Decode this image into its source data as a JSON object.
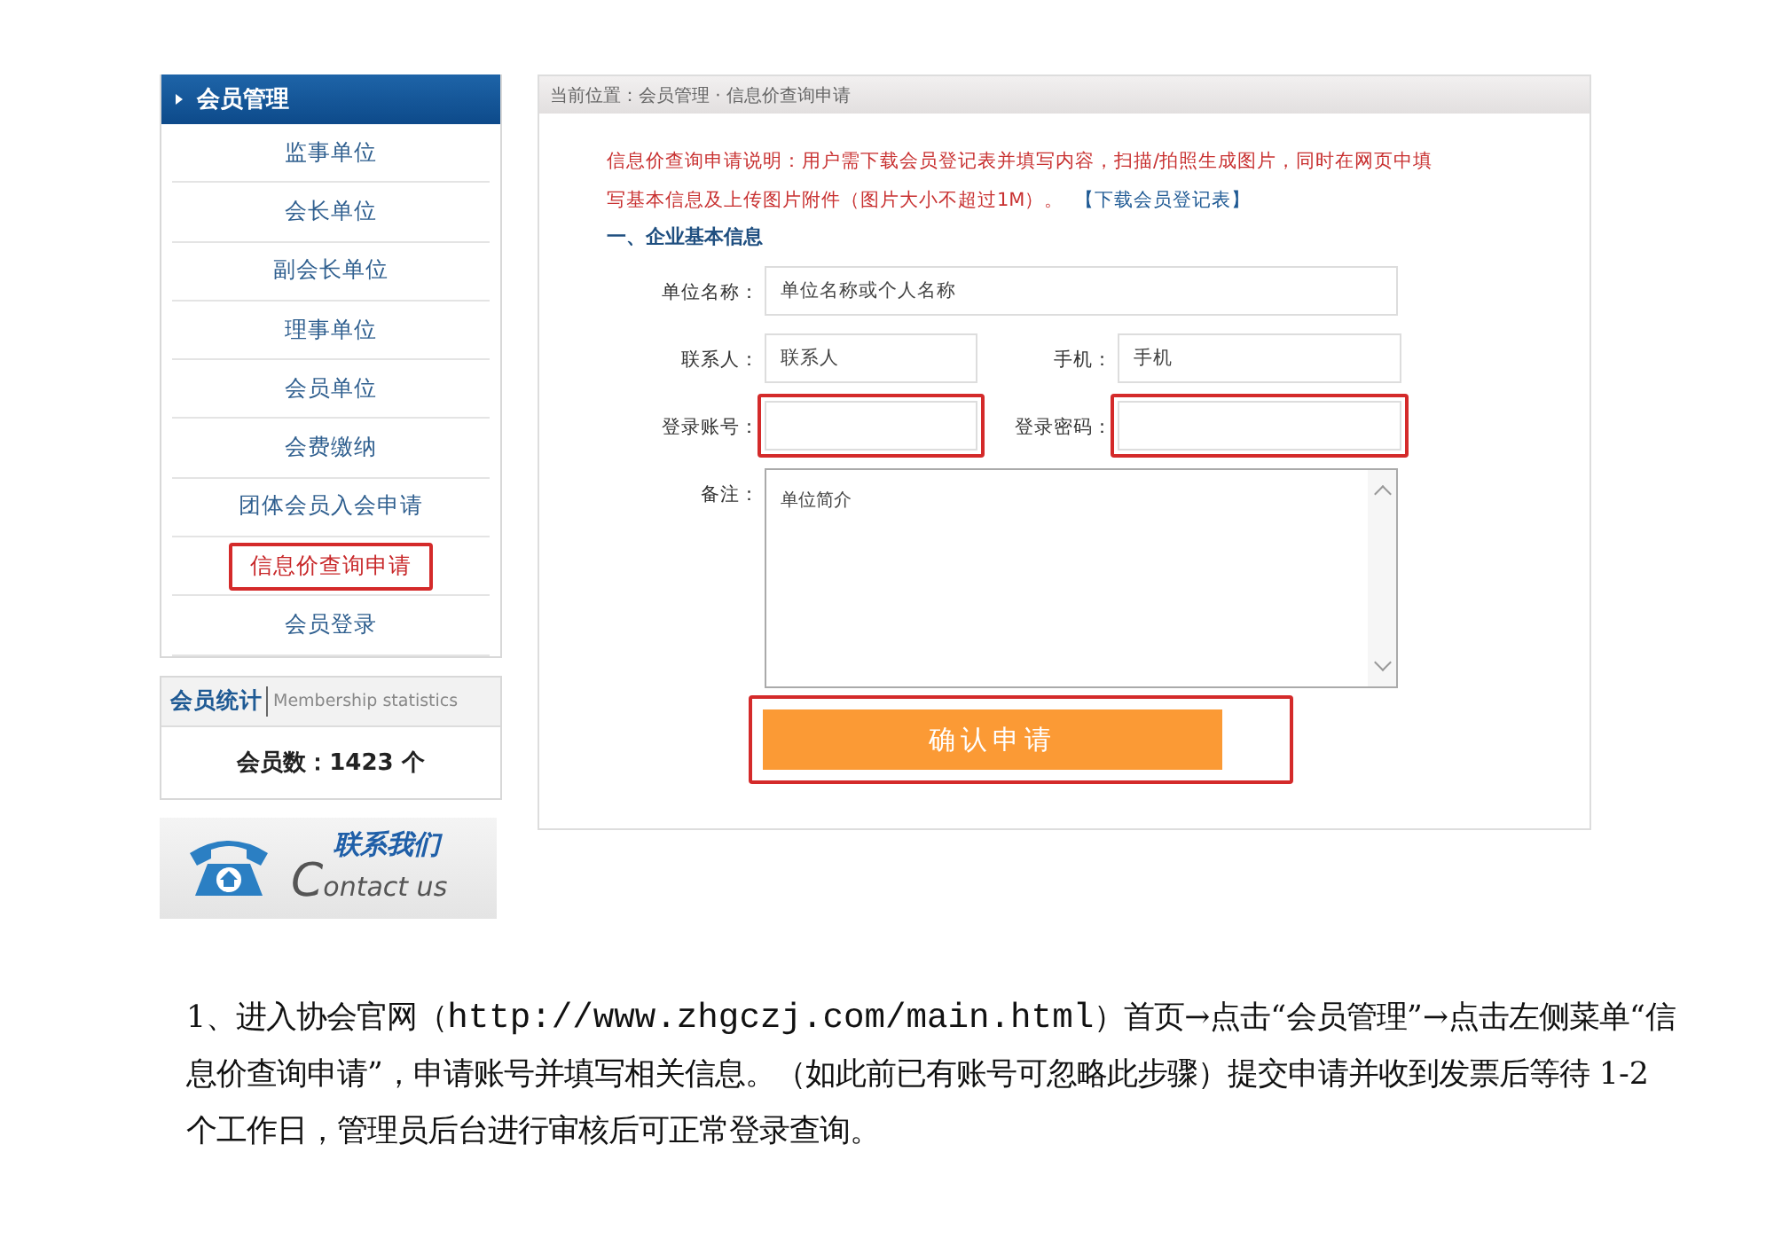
{
  "sidebar": {
    "title": "会员管理",
    "items": [
      {
        "label": "监事单位",
        "selected": false,
        "highlighted": false
      },
      {
        "label": "会长单位",
        "selected": false,
        "highlighted": false
      },
      {
        "label": "副会长单位",
        "selected": false,
        "highlighted": false
      },
      {
        "label": "理事单位",
        "selected": false,
        "highlighted": false
      },
      {
        "label": "会员单位",
        "selected": false,
        "highlighted": false
      },
      {
        "label": "会费缴纳",
        "selected": false,
        "highlighted": false
      },
      {
        "label": "团体会员入会申请",
        "selected": false,
        "highlighted": false
      },
      {
        "label": "信息价查询申请",
        "selected": true,
        "highlighted": true
      },
      {
        "label": "会员登录",
        "selected": false,
        "highlighted": false
      }
    ]
  },
  "stats": {
    "title": "会员统计",
    "subtitle": "Membership statistics",
    "count": "会员数：1423 个"
  },
  "contact": {
    "title": "联系我们",
    "subtitle": "Contact us"
  },
  "main": {
    "breadcrumb": "当前位置：会员管理 · 信息价查询申请",
    "notice": "信息价查询申请说明：用户需下载会员登记表并填写内容，扫描/拍照生成图片，同时在网页中填写基本信息及上传图片附件（图片大小不超过1M）。",
    "notice_link": "【下载会员登记表】",
    "section_title": "一、企业基本信息",
    "rows": [
      {
        "fields": [
          {
            "kind": "input",
            "label": "单位名称：",
            "placeholder": "单位名称或个人名称",
            "highlighted": false
          }
        ]
      },
      {
        "fields": [
          {
            "kind": "input",
            "label": "联系人：",
            "placeholder": "联系人",
            "highlighted": false
          },
          {
            "kind": "input",
            "label": "手机：",
            "placeholder": "手机",
            "highlighted": false
          }
        ]
      },
      {
        "fields": [
          {
            "kind": "input",
            "label": "登录账号：",
            "highlighted": true
          },
          {
            "kind": "input",
            "label": "登录密码：",
            "highlighted": true
          }
        ]
      },
      {
        "fields": [
          {
            "kind": "textarea",
            "label": "备注：",
            "placeholder": "单位简介",
            "highlighted": false
          }
        ]
      }
    ],
    "submit": {
      "label": "确认申请",
      "highlighted": true
    }
  },
  "paragraph": {
    "before": "1、进入协会官网（",
    "link": "http://www.zhgczj.com/main.html",
    "after": "）首页→点击“会员管理”→点击左侧菜单“信息价查询申请”，申请账号并填写相关信息。（如此前已有账号可忽略此步骤）提交申请并收到发票后等待 1-2 个工作日，管理员后台进行审核后可正常登录查询。"
  }
}
